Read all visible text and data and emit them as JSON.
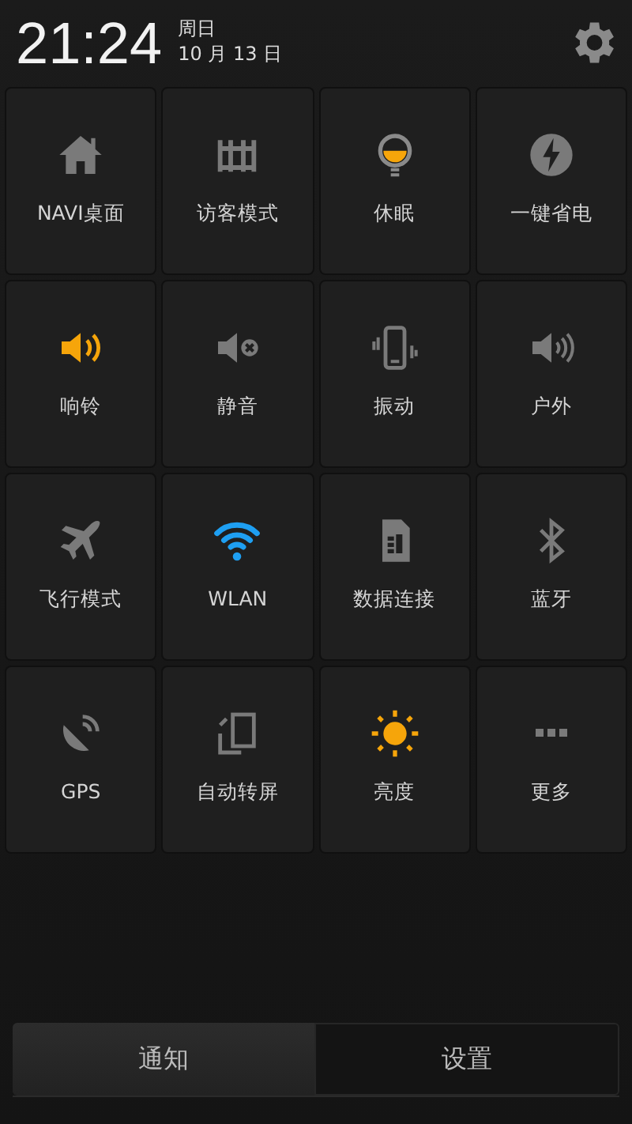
{
  "header": {
    "time": "21:24",
    "weekday": "周日",
    "date": "10 月 13 日"
  },
  "toggles": [
    {
      "kind": "home",
      "label": "NAVI桌面",
      "on": false
    },
    {
      "kind": "fence",
      "label": "访客模式",
      "on": false
    },
    {
      "kind": "bulb",
      "label": "休眠",
      "on": true
    },
    {
      "kind": "bolt",
      "label": "一键省电",
      "on": false
    },
    {
      "kind": "ring",
      "label": "响铃",
      "on": true
    },
    {
      "kind": "mute",
      "label": "静音",
      "on": false
    },
    {
      "kind": "vibrate",
      "label": "振动",
      "on": false
    },
    {
      "kind": "outdoor",
      "label": "户外",
      "on": false
    },
    {
      "kind": "plane",
      "label": "飞行模式",
      "on": false
    },
    {
      "kind": "wifi",
      "label": "WLAN",
      "on": true
    },
    {
      "kind": "sim",
      "label": "数据连接",
      "on": false
    },
    {
      "kind": "bt",
      "label": "蓝牙",
      "on": false
    },
    {
      "kind": "gps",
      "label": "GPS",
      "on": false
    },
    {
      "kind": "rotate",
      "label": "自动转屏",
      "on": false
    },
    {
      "kind": "sun",
      "label": "亮度",
      "on": true
    },
    {
      "kind": "more",
      "label": "更多",
      "on": false
    }
  ],
  "tabs": [
    {
      "label": "通知",
      "selected": false
    },
    {
      "label": "设置",
      "selected": true
    }
  ]
}
